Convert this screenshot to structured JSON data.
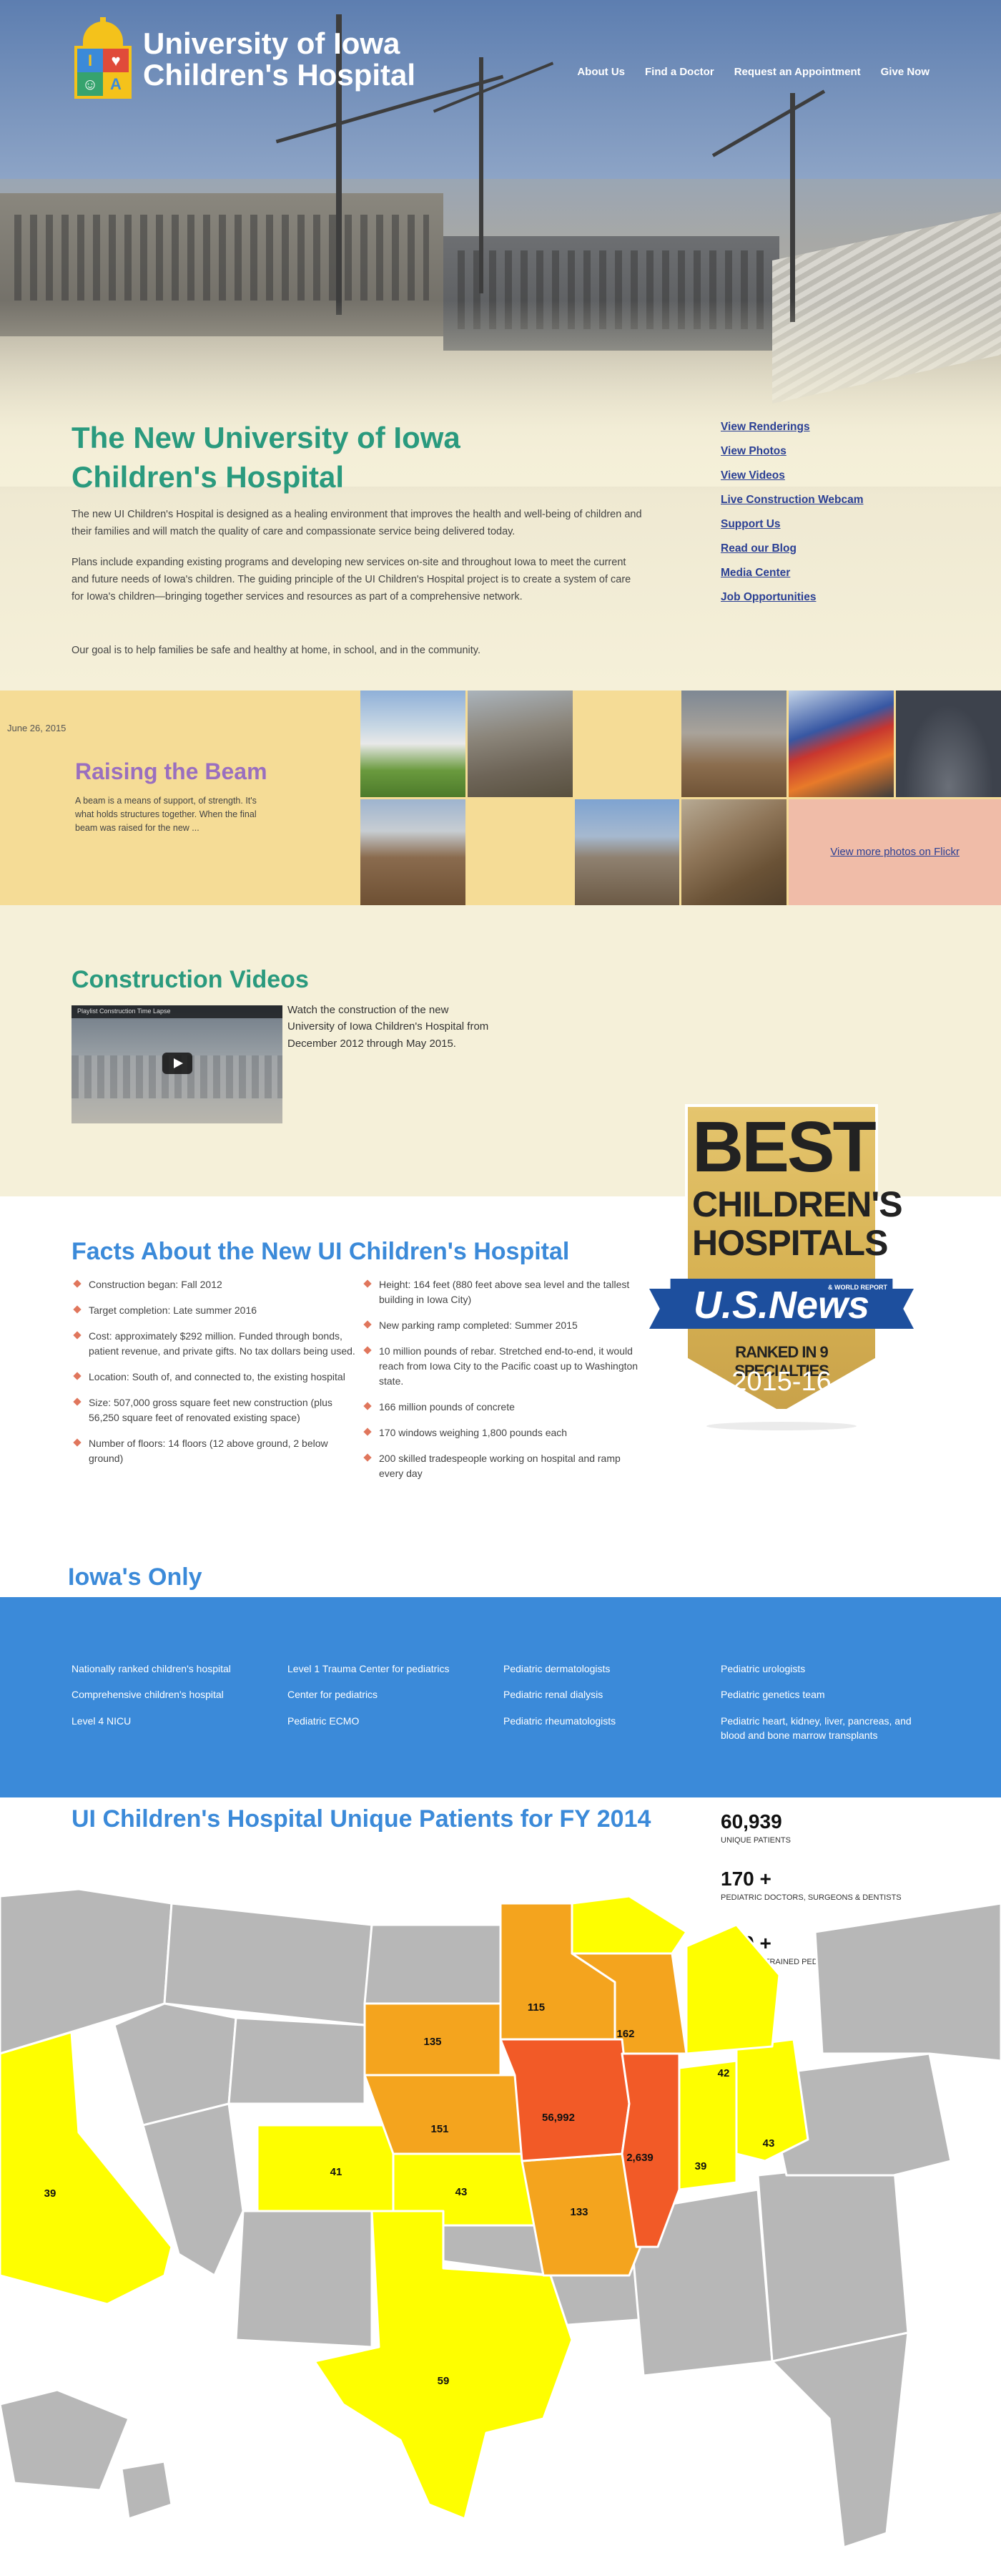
{
  "header": {
    "logo_line1": "University of Iowa",
    "logo_line2": "Children's Hospital",
    "logo_letters": [
      "I",
      "♥",
      "☺",
      "A"
    ],
    "nav": [
      "About Us",
      "Find a Doctor",
      "Request an Appointment",
      "Give Now"
    ]
  },
  "intro": {
    "title": "The New University of Iowa Children's Hospital",
    "p1": "The new UI Children's Hospital is designed as a healing environment that improves the health and well-being of children and their families and will match the quality of care and compassionate service being delivered today.",
    "p2": "Plans include expanding existing programs and developing new services on-site and throughout Iowa to meet the current and future needs of Iowa's children. The guiding principle of the UI Children's Hospital project is to create a system of care for Iowa's children—bringing together services and resources as part of a comprehensive network.",
    "p3": "Our goal is to help families be safe and healthy at home, in school, and in the community."
  },
  "sidelinks": [
    "View Renderings",
    "View Photos",
    "View Videos",
    "Live Construction Webcam",
    "Support Us",
    "Read our Blog",
    "Media Center",
    "Job Opportunities"
  ],
  "beam": {
    "date": "June 26, 2015",
    "title": "Raising the Beam",
    "text": "A beam is a means of support, of strength. It's what holds structures together. When the final beam was raised for the new ...",
    "flickr_link": "View more photos on Flickr"
  },
  "videos": {
    "title": "Construction Videos",
    "bar_text": "Playlist     Construction Time Lapse",
    "desc": "Watch the construction of the new University of Iowa Children's Hospital from December 2012 through May 2015."
  },
  "facts": {
    "title": "Facts About the New UI Children's Hospital",
    "left": [
      "Construction began: Fall 2012",
      "Target completion: Late summer 2016",
      "Cost: approximately $292 million. Funded through bonds, patient revenue, and private gifts. No tax dollars being used.",
      "Location: South of, and connected to, the existing hospital",
      "Size: 507,000 gross square feet new construction (plus 56,250 square feet of renovated existing space)",
      "Number of floors: 14 floors (12 above ground, 2 below ground)"
    ],
    "right": [
      "Height: 164 feet (880 feet above sea level and the tallest building in Iowa City)",
      "New parking ramp completed: Summer 2015",
      "10 million pounds of rebar. Stretched end-to-end, it would reach from Iowa City to the Pacific coast up to Washington state.",
      "166 million pounds of concrete",
      "170 windows weighing 1,800 pounds each",
      "200 skilled tradespeople working on hospital and ramp every day"
    ]
  },
  "badge": {
    "best": "BEST",
    "line2": "CHILDREN'S",
    "line3": "HOSPITALS",
    "usnews": "U.S.News",
    "world_report": "& WORLD REPORT",
    "ranked": "RANKED IN 9 SPECIALTIES",
    "year": "2015-16"
  },
  "only": {
    "title": "Iowa's Only",
    "col1": [
      "Nationally ranked children's hospital",
      "Comprehensive children's hospital",
      "Level 4 NICU"
    ],
    "col2": [
      "Level 1 Trauma Center for pediatrics",
      "Center for pediatrics",
      "Pediatric ECMO"
    ],
    "col3": [
      "Pediatric dermatologists",
      "Pediatric renal dialysis",
      "Pediatric rheumatologists"
    ],
    "col4": [
      "Pediatric urologists",
      "Pediatric genetics team",
      "Pediatric heart, kidney, liver, pancreas, and blood and bone marrow transplants"
    ]
  },
  "patients": {
    "title": "UI Children's Hospital Unique Patients for FY 2014",
    "stats": [
      {
        "num": "60,939",
        "label": "Unique patients"
      },
      {
        "num": "170 +",
        "label": "Pediatric doctors, surgeons & dentists"
      },
      {
        "num": "500 +",
        "label": "Specially trained pediatric nurses"
      }
    ],
    "colors": {
      "gray": "#b7b7b7",
      "yellow": "#fefe00",
      "orange": "#f4a41e",
      "red": "#f25a27"
    },
    "states": [
      {
        "name": "Iowa",
        "value": "56,992",
        "tier": "red"
      },
      {
        "name": "Illinois",
        "value": "2,639",
        "tier": "red"
      },
      {
        "name": "Nebraska",
        "value": "151",
        "tier": "orange"
      },
      {
        "name": "South Dakota",
        "value": "135",
        "tier": "orange"
      },
      {
        "name": "Minnesota",
        "value": "115",
        "tier": "orange"
      },
      {
        "name": "Wisconsin",
        "value": "162",
        "tier": "orange"
      },
      {
        "name": "Missouri",
        "value": "133",
        "tier": "orange"
      },
      {
        "name": "Kansas",
        "value": "43",
        "tier": "yellow"
      },
      {
        "name": "Colorado",
        "value": "41",
        "tier": "yellow"
      },
      {
        "name": "Texas",
        "value": "59",
        "tier": "yellow"
      },
      {
        "name": "California",
        "value": "39",
        "tier": "yellow"
      },
      {
        "name": "Indiana",
        "value": "39",
        "tier": "yellow"
      },
      {
        "name": "Ohio",
        "value": "43",
        "tier": "yellow"
      },
      {
        "name": "Michigan",
        "value": "42",
        "tier": "yellow"
      }
    ]
  }
}
